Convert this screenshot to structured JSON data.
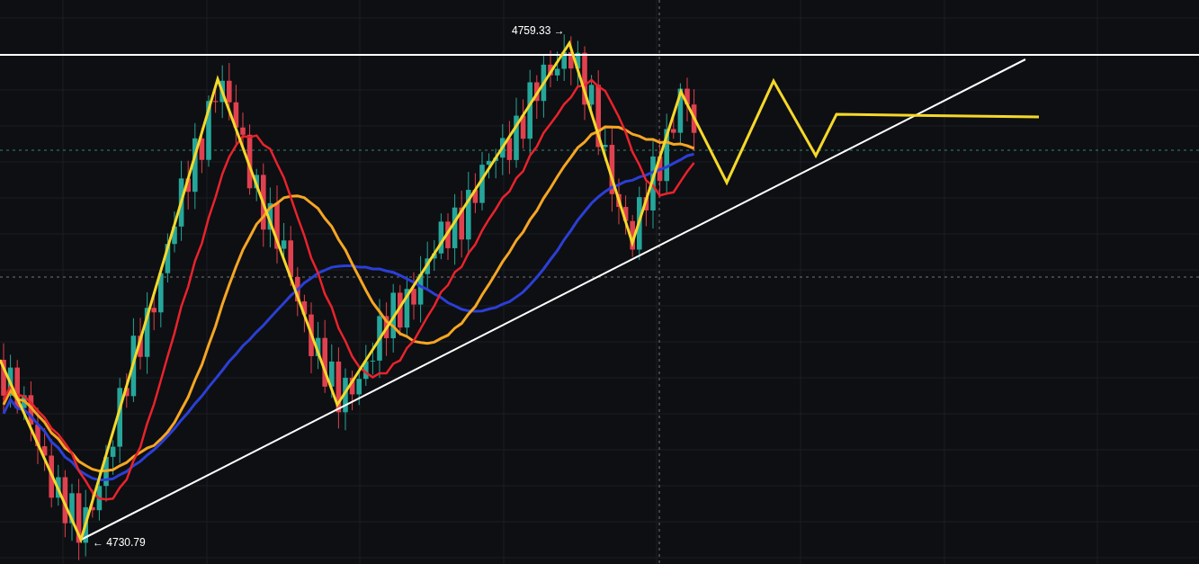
{
  "chart": {
    "high_label": "4759.33 →",
    "low_label": "← 4730.79"
  }
}
